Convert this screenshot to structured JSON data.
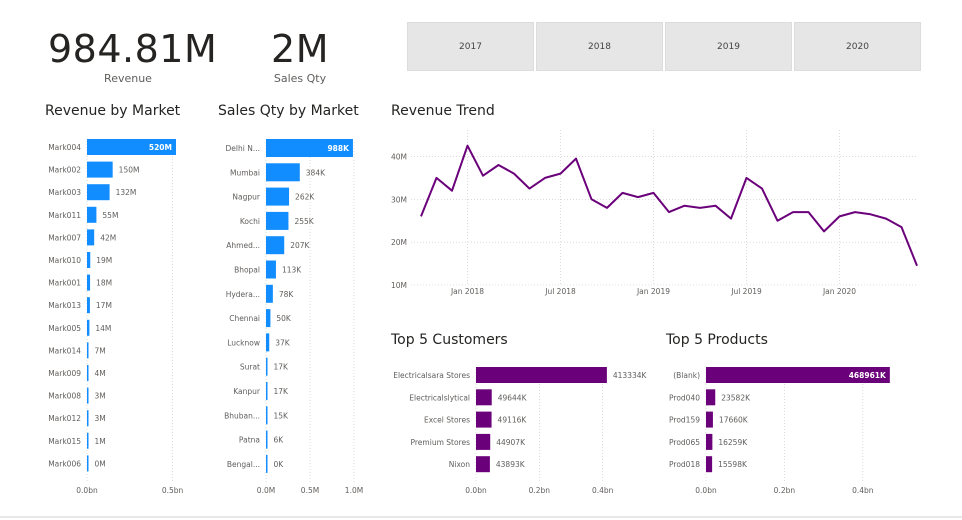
{
  "kpis": {
    "revenue": {
      "value": "984.81M",
      "label": "Revenue"
    },
    "sales_qty": {
      "value": "2M",
      "label": "Sales Qty"
    }
  },
  "year_slicer": [
    "2017",
    "2018",
    "2019",
    "2020"
  ],
  "colors": {
    "blue": "#118dff",
    "purple": "#6b007b",
    "text": "#605e5c",
    "grid": "#c8c6c4"
  },
  "chart_data": [
    {
      "id": "revenue_by_market",
      "type": "bar",
      "orientation": "horizontal",
      "title": "Revenue by Market",
      "categories": [
        "Mark004",
        "Mark002",
        "Mark003",
        "Mark011",
        "Mark007",
        "Mark010",
        "Mark001",
        "Mark013",
        "Mark005",
        "Mark014",
        "Mark009",
        "Mark008",
        "Mark012",
        "Mark015",
        "Mark006"
      ],
      "values": [
        520,
        150,
        132,
        55,
        42,
        19,
        18,
        17,
        14,
        7,
        4,
        3,
        3,
        1,
        0
      ],
      "value_labels": [
        "520M",
        "150M",
        "132M",
        "55M",
        "42M",
        "19M",
        "18M",
        "17M",
        "14M",
        "7M",
        "4M",
        "3M",
        "3M",
        "1M",
        "0M"
      ],
      "unit": "M",
      "xlim": [
        0,
        520
      ],
      "x_ticks": [
        {
          "value": 0,
          "label": "0.0bn"
        },
        {
          "value": 500,
          "label": "0.5bn"
        }
      ],
      "grid": true
    },
    {
      "id": "sales_qty_by_market",
      "type": "bar",
      "orientation": "horizontal",
      "title": "Sales Qty by Market",
      "categories": [
        "Delhi N...",
        "Mumbai",
        "Nagpur",
        "Kochi",
        "Ahmed...",
        "Bhopal",
        "Hydera...",
        "Chennai",
        "Lucknow",
        "Surat",
        "Kanpur",
        "Bhuban...",
        "Patna",
        "Bengal..."
      ],
      "values": [
        988,
        384,
        262,
        255,
        207,
        113,
        78,
        50,
        37,
        17,
        17,
        15,
        6,
        0
      ],
      "value_labels": [
        "988K",
        "384K",
        "262K",
        "255K",
        "207K",
        "113K",
        "78K",
        "50K",
        "37K",
        "17K",
        "17K",
        "15K",
        "6K",
        "0K"
      ],
      "unit": "K",
      "xlim": [
        0,
        1000
      ],
      "x_ticks": [
        {
          "value": 0,
          "label": "0.0M"
        },
        {
          "value": 500,
          "label": "0.5M"
        },
        {
          "value": 1000,
          "label": "1.0M"
        }
      ],
      "grid": true
    },
    {
      "id": "revenue_trend",
      "type": "line",
      "title": "Revenue Trend",
      "x": [
        "2017-10",
        "2017-11",
        "2017-12",
        "2018-01",
        "2018-02",
        "2018-03",
        "2018-04",
        "2018-05",
        "2018-06",
        "2018-07",
        "2018-08",
        "2018-09",
        "2018-10",
        "2018-11",
        "2018-12",
        "2019-01",
        "2019-02",
        "2019-03",
        "2019-04",
        "2019-05",
        "2019-06",
        "2019-07",
        "2019-08",
        "2019-09",
        "2019-10",
        "2019-11",
        "2019-12",
        "2020-01",
        "2020-02",
        "2020-03",
        "2020-04",
        "2020-05",
        "2020-06"
      ],
      "y": [
        26,
        35,
        32,
        42.5,
        35.5,
        38,
        36,
        32.5,
        35,
        36,
        39.5,
        30,
        28,
        31.5,
        30.5,
        31.5,
        27,
        28.5,
        28,
        28.5,
        25.5,
        35,
        32.5,
        25,
        27,
        27,
        22.5,
        26,
        27,
        26.5,
        25.5,
        23.5,
        14.5
      ],
      "ylim": [
        10,
        45
      ],
      "y_ticks": [
        {
          "value": 10,
          "label": "10M"
        },
        {
          "value": 20,
          "label": "20M"
        },
        {
          "value": 30,
          "label": "30M"
        },
        {
          "value": 40,
          "label": "40M"
        }
      ],
      "x_ticks": [
        {
          "value": "2018-01",
          "label": "Jan 2018"
        },
        {
          "value": "2018-07",
          "label": "Jul 2018"
        },
        {
          "value": "2019-01",
          "label": "Jan 2019"
        },
        {
          "value": "2019-07",
          "label": "Jul 2019"
        },
        {
          "value": "2020-01",
          "label": "Jan 2020"
        }
      ],
      "grid": true
    },
    {
      "id": "top5_customers",
      "type": "bar",
      "orientation": "horizontal",
      "title": "Top 5 Customers",
      "categories": [
        "Electricalsara Stores",
        "Electricalslytical",
        "Excel Stores",
        "Premium Stores",
        "Nixon"
      ],
      "values": [
        413334,
        49644,
        49116,
        44907,
        43893
      ],
      "value_labels": [
        "413334K",
        "49644K",
        "49116K",
        "44907K",
        "43893K"
      ],
      "unit": "K",
      "xlim": [
        0,
        480000
      ],
      "x_ticks": [
        {
          "value": 0,
          "label": "0.0bn"
        },
        {
          "value": 200000,
          "label": "0.2bn"
        },
        {
          "value": 400000,
          "label": "0.4bn"
        }
      ],
      "grid": true
    },
    {
      "id": "top5_products",
      "type": "bar",
      "orientation": "horizontal",
      "title": "Top 5 Products",
      "categories": [
        "(Blank)",
        "Prod040",
        "Prod159",
        "Prod065",
        "Prod018"
      ],
      "values": [
        468961,
        23582,
        17660,
        16259,
        15598
      ],
      "value_labels": [
        "468961K",
        "23582K",
        "17660K",
        "16259K",
        "15598K"
      ],
      "unit": "K",
      "xlim": [
        0,
        500000
      ],
      "x_ticks": [
        {
          "value": 0,
          "label": "0.0bn"
        },
        {
          "value": 200000,
          "label": "0.2bn"
        },
        {
          "value": 400000,
          "label": "0.4bn"
        }
      ],
      "grid": true
    }
  ]
}
